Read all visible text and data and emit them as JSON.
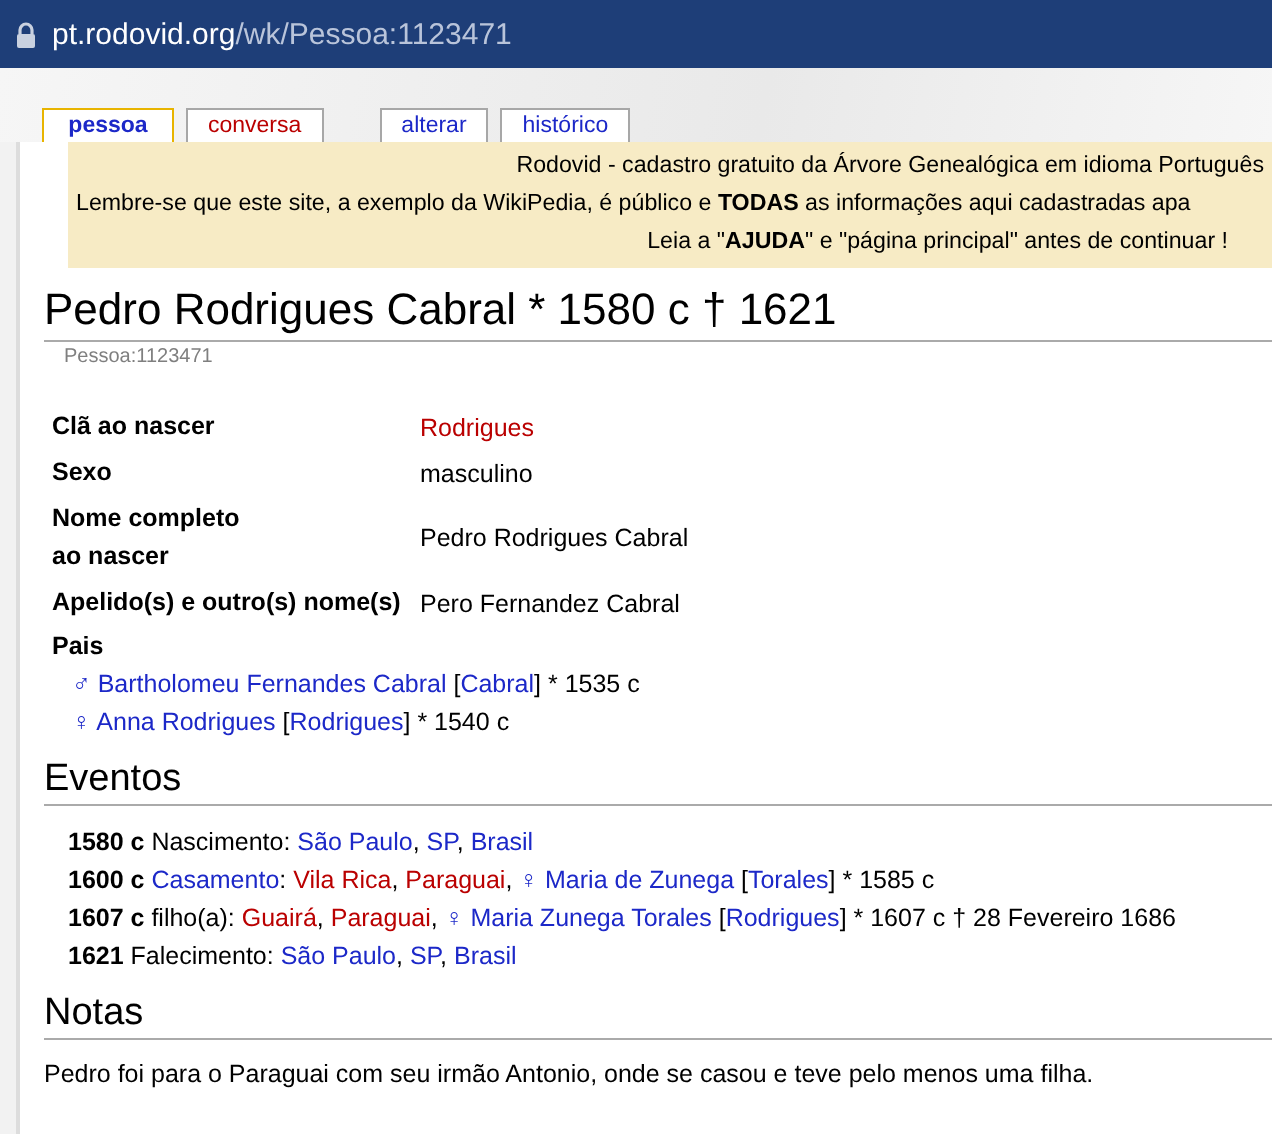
{
  "address_bar": {
    "host": "pt.rodovid.org",
    "path": "/wk/Pessoa:1123471"
  },
  "tabs": [
    {
      "label": "pessoa",
      "selected": true,
      "kind": "link"
    },
    {
      "label": "conversa",
      "selected": false,
      "kind": "redlink"
    },
    {
      "label": "alterar",
      "selected": false,
      "kind": "link"
    },
    {
      "label": "histórico",
      "selected": false,
      "kind": "link"
    }
  ],
  "banner": [
    "Rodovid - cadastro gratuito da Árvore Genealógica em idioma Português",
    "Lembre-se que este site, a exemplo da WikiPedia, é público e **TODAS** as informações aqui cadastradas apa",
    "Leia a \"**AJUDA**\" e \"página principal\" antes de continuar !"
  ],
  "title": "Pedro Rodrigues Cabral * 1580 c † 1621",
  "subtitle": "Pessoa:1123471",
  "facts": [
    {
      "label_lines": [
        "Clã ao nascer"
      ],
      "value": "Rodrigues",
      "kind": "redlink"
    },
    {
      "label_lines": [
        "Sexo"
      ],
      "value": "masculino",
      "kind": "text"
    },
    {
      "label_lines": [
        "Nome completo",
        "ao nascer"
      ],
      "value": "Pedro Rodrigues Cabral",
      "kind": "text"
    },
    {
      "label_lines": [
        "Apelido(s) e outro(s) nome(s)"
      ],
      "value": "Pero Fernandez Cabral",
      "kind": "text"
    }
  ],
  "parents": {
    "label": "Pais",
    "lines": [
      [
        {
          "kind": "link",
          "text": "♂ Bartholomeu Fernandes Cabral"
        },
        {
          "kind": "text",
          "text": " ["
        },
        {
          "kind": "link",
          "text": "Cabral"
        },
        {
          "kind": "text",
          "text": "] * 1535 c"
        }
      ],
      [
        {
          "kind": "link",
          "text": "♀ Anna Rodrigues"
        },
        {
          "kind": "text",
          "text": " ["
        },
        {
          "kind": "link",
          "text": "Rodrigues"
        },
        {
          "kind": "text",
          "text": "] * 1540 c"
        }
      ]
    ]
  },
  "events": {
    "heading": "Eventos",
    "lines": [
      [
        {
          "kind": "bold",
          "text": "1580 c"
        },
        {
          "kind": "text",
          "text": " Nascimento: "
        },
        {
          "kind": "link",
          "text": "São Paulo"
        },
        {
          "kind": "text",
          "text": ", "
        },
        {
          "kind": "link",
          "text": "SP"
        },
        {
          "kind": "text",
          "text": ", "
        },
        {
          "kind": "link",
          "text": "Brasil"
        }
      ],
      [
        {
          "kind": "bold",
          "text": "1600 c "
        },
        {
          "kind": "link",
          "text": "Casamento"
        },
        {
          "kind": "text",
          "text": ": "
        },
        {
          "kind": "redlink",
          "text": "Vila Rica"
        },
        {
          "kind": "text",
          "text": ", "
        },
        {
          "kind": "redlink",
          "text": "Paraguai"
        },
        {
          "kind": "text",
          "text": ", "
        },
        {
          "kind": "link",
          "text": "♀ Maria de Zunega"
        },
        {
          "kind": "text",
          "text": " ["
        },
        {
          "kind": "link",
          "text": "Torales"
        },
        {
          "kind": "text",
          "text": "] * 1585 c"
        }
      ],
      [
        {
          "kind": "bold",
          "text": "1607 c"
        },
        {
          "kind": "text",
          "text": " filho(a): "
        },
        {
          "kind": "redlink",
          "text": "Guairá"
        },
        {
          "kind": "text",
          "text": ", "
        },
        {
          "kind": "redlink",
          "text": "Paraguai"
        },
        {
          "kind": "text",
          "text": ", "
        },
        {
          "kind": "link",
          "text": "♀ Maria Zunega Torales"
        },
        {
          "kind": "text",
          "text": " ["
        },
        {
          "kind": "link",
          "text": "Rodrigues"
        },
        {
          "kind": "text",
          "text": "] * 1607 c † 28 Fevereiro 1686"
        }
      ],
      [
        {
          "kind": "bold",
          "text": "1621"
        },
        {
          "kind": "text",
          "text": " Falecimento: "
        },
        {
          "kind": "link",
          "text": "São Paulo"
        },
        {
          "kind": "text",
          "text": ", "
        },
        {
          "kind": "link",
          "text": "SP"
        },
        {
          "kind": "text",
          "text": ", "
        },
        {
          "kind": "link",
          "text": "Brasil"
        }
      ]
    ]
  },
  "notes": {
    "heading": "Notas",
    "text": "Pedro foi para o Paraguai com seu irmão Antonio, onde se casou e teve pelo menos uma filha."
  }
}
